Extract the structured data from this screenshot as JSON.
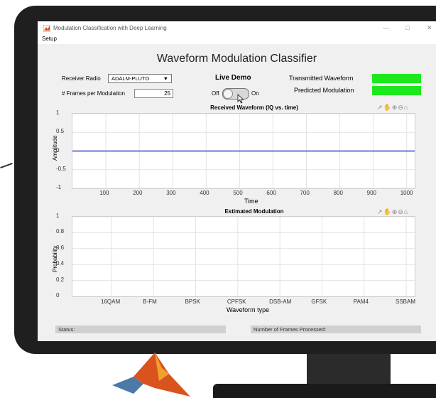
{
  "window": {
    "title": "Modulation Classification with Deep Learning",
    "controls": [
      "—",
      "□",
      "✕"
    ]
  },
  "menu": {
    "setup": "Setup"
  },
  "app": {
    "title": "Waveform Modulation Classifier"
  },
  "controls": {
    "receiver_label": "Receiver Radio",
    "receiver_value": "ADALM-PLUTO",
    "frames_label": "# Frames per Modulation",
    "frames_value": "25",
    "live_demo_label": "Live Demo",
    "toggle_off": "Off",
    "toggle_on": "On",
    "transmitted_label": "Transmitted Waveform",
    "predicted_label": "Predicted Modulation",
    "indicator_color": "#1de81d"
  },
  "plots": {
    "toolbar_icons": [
      "export-icon",
      "pan-icon",
      "zoom-in-icon",
      "zoom-out-icon",
      "home-icon"
    ]
  },
  "chart_data": [
    {
      "type": "line",
      "title": "Received Waveform (IQ vs. time)",
      "xlabel": "Time",
      "ylabel": "Amplitude",
      "xlim": [
        0,
        1024
      ],
      "ylim": [
        -1,
        1
      ],
      "xticks": [
        100,
        200,
        300,
        400,
        500,
        600,
        700,
        800,
        900,
        1000
      ],
      "yticks": [
        1,
        0.5,
        0,
        -0.5,
        -1
      ],
      "ytick_labels": [
        "1",
        "0.5",
        "0",
        "-0.5",
        "-1"
      ],
      "grid": true,
      "series": [
        {
          "x": [
            0,
            1024
          ],
          "y": [
            0,
            0
          ],
          "color": "#3b3bd6"
        }
      ]
    },
    {
      "type": "bar",
      "title": "Estimated Modulation",
      "xlabel": "Waveform type",
      "ylabel": "Probability",
      "ylim": [
        0,
        1
      ],
      "yticks": [
        0,
        0.2,
        0.4,
        0.6,
        0.8,
        1
      ],
      "ytick_labels": [
        "0",
        "0.2",
        "0.4",
        "0.6",
        "0.8",
        "1"
      ],
      "grid": true,
      "categories": [
        "16QAM",
        "B-FM",
        "BPSK",
        "CPFSK",
        "DSB-AM",
        "GFSK",
        "PAM4",
        "SSBAM"
      ],
      "values": [
        0,
        0,
        0,
        0,
        0,
        0,
        0,
        0
      ]
    }
  ],
  "status": {
    "status_label": "Status:",
    "frames_processed_label": "Number of Frames Processed:"
  }
}
